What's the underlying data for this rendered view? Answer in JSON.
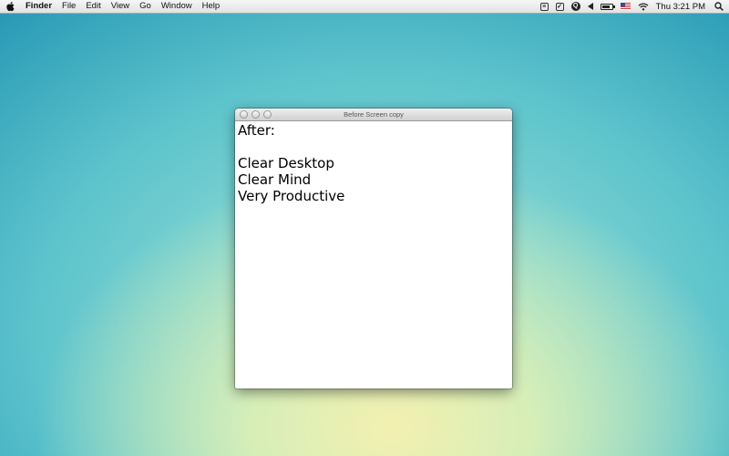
{
  "menubar": {
    "apple_icon": "apple-icon",
    "items": [
      "Finder",
      "File",
      "Edit",
      "View",
      "Go",
      "Window",
      "Help"
    ],
    "status_icons": [
      "script-icon",
      "clipboard-icon",
      "sync-icon",
      "volume-icon",
      "battery-icon",
      "us-flag-icon",
      "wifi-icon"
    ],
    "clock": "Thu 3:21 PM",
    "search_icon": "spotlight-icon"
  },
  "window": {
    "title": "Before Screen copy",
    "lines": [
      "After:",
      "",
      "Clear Desktop",
      "Clear Mind",
      "Very Productive"
    ]
  },
  "colors": {
    "desktop_top": "#1f86a7",
    "desktop_center": "#a5e6d6",
    "desktop_bottom": "#f3f0b0"
  }
}
